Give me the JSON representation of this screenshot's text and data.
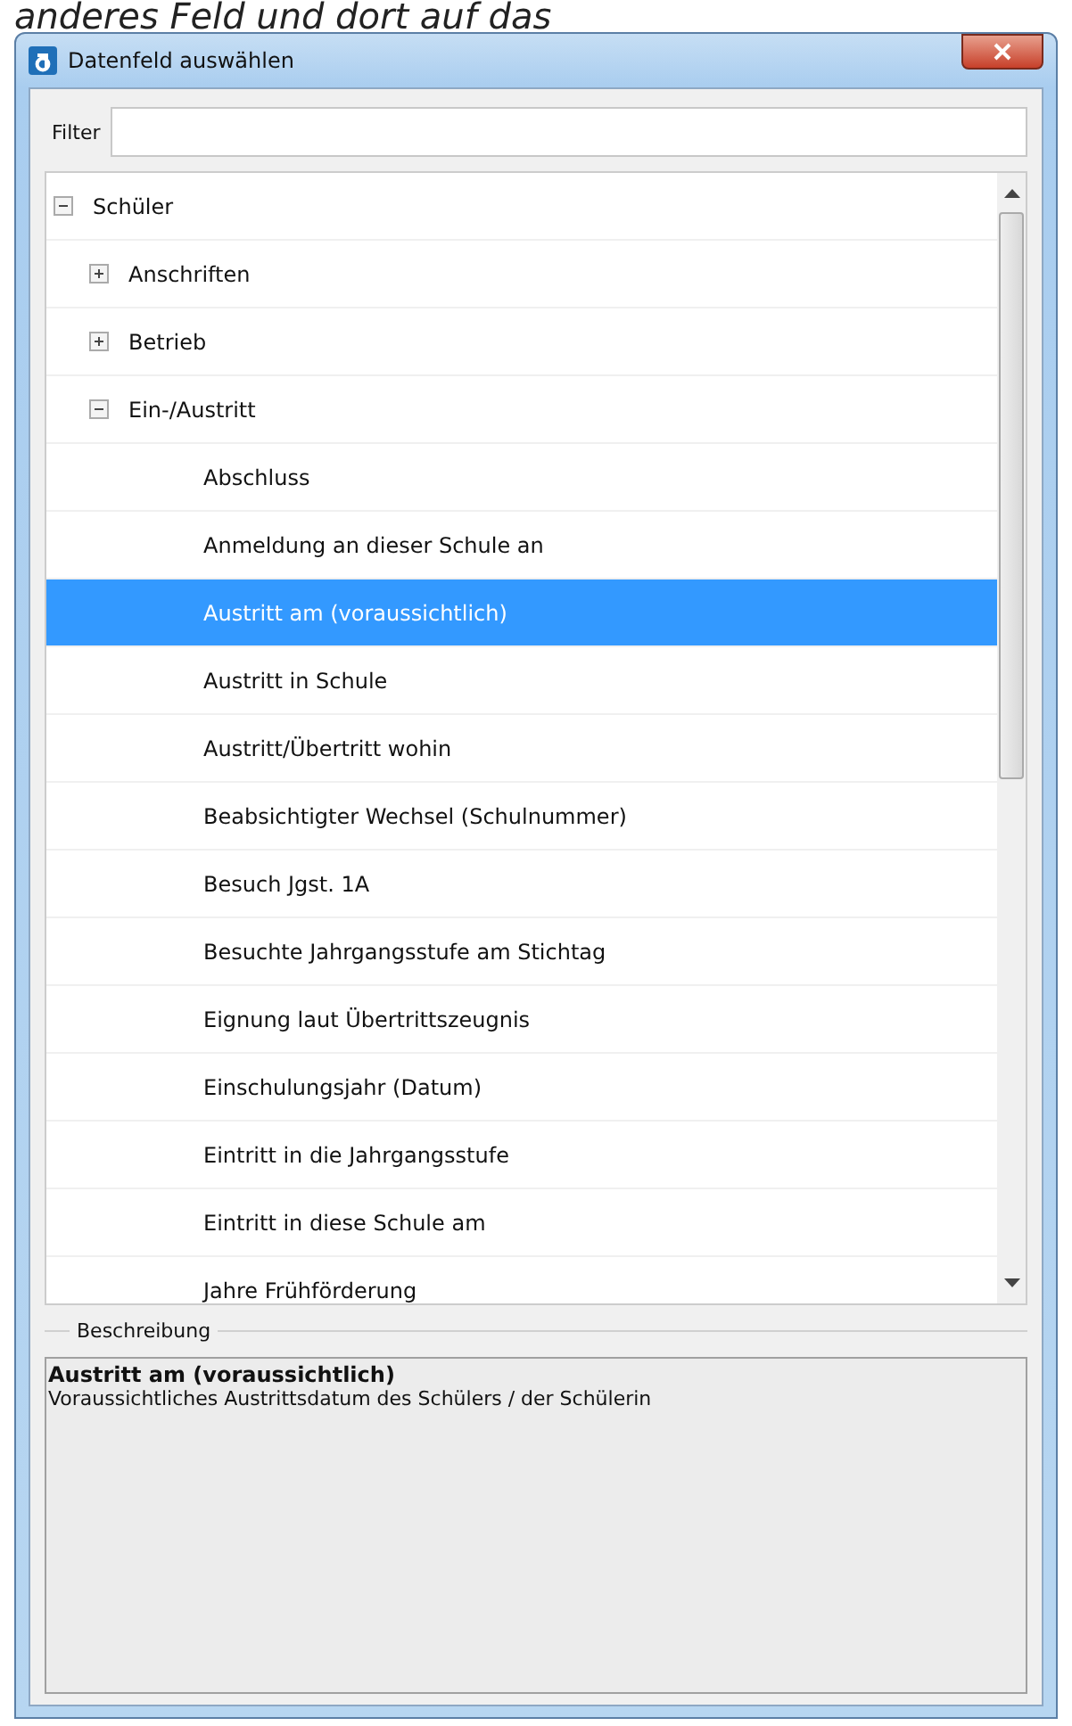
{
  "page_caption": "anderes Feld und dort auf das",
  "window": {
    "title": "Datenfeld auswählen"
  },
  "filter": {
    "label": "Filter"
  },
  "tree": [
    {
      "label": "Schüler",
      "expanded": true,
      "children": [
        {
          "label": "Anschriften",
          "expanded": false
        },
        {
          "label": "Betrieb",
          "expanded": false
        },
        {
          "label": "Ein-/Austritt",
          "expanded": true,
          "children": [
            {
              "label": "Abschluss",
              "selected": false
            },
            {
              "label": "Anmeldung an dieser Schule an",
              "selected": false
            },
            {
              "label": "Austritt am (voraussichtlich)",
              "selected": true
            },
            {
              "label": "Austritt in Schule",
              "selected": false
            },
            {
              "label": "Austritt/Übertritt wohin",
              "selected": false
            },
            {
              "label": "Beabsichtigter Wechsel (Schulnummer)",
              "selected": false
            },
            {
              "label": "Besuch Jgst. 1A",
              "selected": false
            },
            {
              "label": "Besuchte Jahrgangsstufe am Stichtag",
              "selected": false
            },
            {
              "label": "Eignung laut Übertrittszeugnis",
              "selected": false
            },
            {
              "label": "Einschulungsjahr (Datum)",
              "selected": false
            },
            {
              "label": "Eintritt in die Jahrgangsstufe",
              "selected": false
            },
            {
              "label": "Eintritt in diese Schule am",
              "selected": false
            },
            {
              "label": "Jahre Frühförderung",
              "selected": false
            }
          ]
        }
      ]
    }
  ],
  "description": {
    "legend": "Beschreibung",
    "title": "Austritt am (voraussichtlich)",
    "text": "Voraussichtliches Austrittsdatum des Schülers / der Schülerin"
  }
}
